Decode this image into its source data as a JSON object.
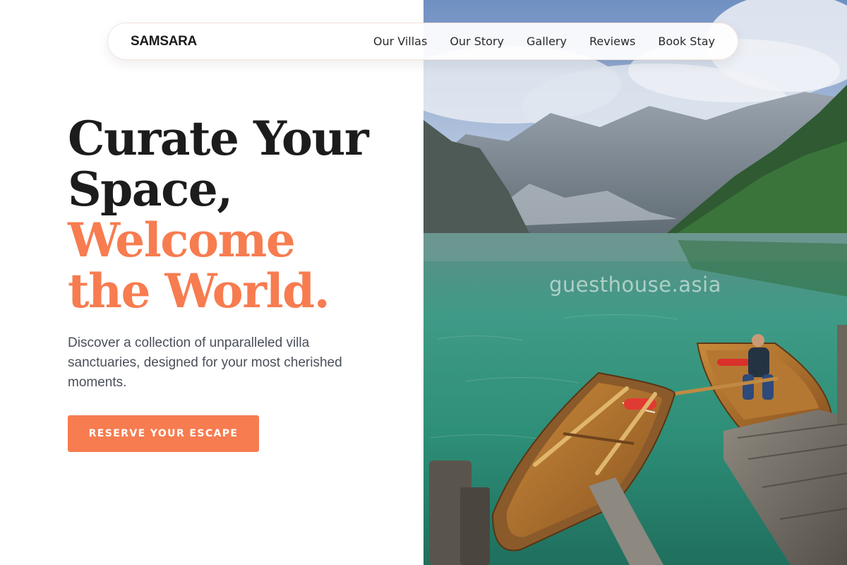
{
  "nav": {
    "brand": "SAMSARA",
    "links": [
      "Our Villas",
      "Our Story",
      "Gallery",
      "Reviews",
      "Book Stay"
    ]
  },
  "hero": {
    "headline_line1": "Curate Your",
    "headline_line2": "Space,",
    "headline_line3": "Welcome",
    "headline_line4": "the World.",
    "description": "Discover a collection of unparalleled villa sanctuaries, designed for your most cherished moments.",
    "cta_label": "RESERVE YOUR ESCAPE"
  },
  "image": {
    "watermark": "guesthouse.asia",
    "alt": "Alpine lake with wooden rowboats beside a dock"
  },
  "colors": {
    "accent": "#f77c50",
    "heading": "#1c1c1c",
    "body_text": "#4a4f5a"
  }
}
